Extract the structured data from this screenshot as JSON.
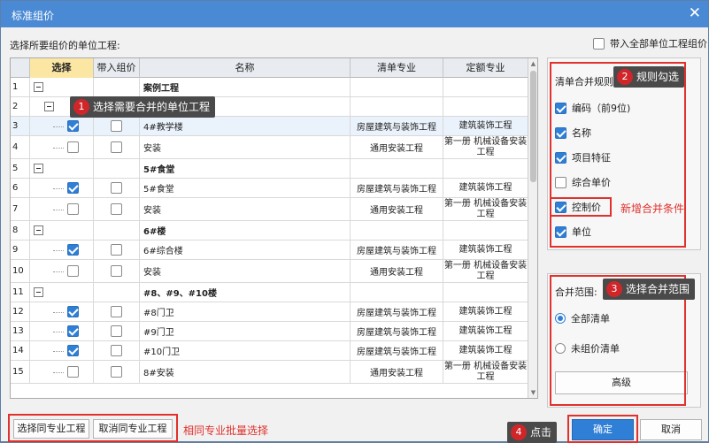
{
  "dialog": {
    "title": "标准组价",
    "close_icon": "✕"
  },
  "instruction": "选择所要组价的单位工程:",
  "bring_all": {
    "label": "带入全部单位工程组价",
    "checked": false
  },
  "grid": {
    "headers": [
      "",
      "选择",
      "带入组价",
      "名称",
      "清单专业",
      "定额专业"
    ],
    "rows": [
      {
        "no": "1",
        "group": true,
        "expander": true,
        "name": "案例工程",
        "qd": "",
        "de": "",
        "sel": null,
        "bring": null
      },
      {
        "no": "2",
        "group": true,
        "expander": true,
        "name": "",
        "qd": "",
        "de": "",
        "sel": null,
        "bring": null
      },
      {
        "no": "3",
        "group": false,
        "name": "4#教学楼",
        "qd": "房屋建筑与装饰工程",
        "de": "建筑装饰工程",
        "sel": true,
        "bring": false,
        "highlight": true
      },
      {
        "no": "4",
        "group": false,
        "name": "安装",
        "qd": "通用安装工程",
        "de": "第一册 机械设备安装工程",
        "sel": false,
        "bring": false
      },
      {
        "no": "5",
        "group": true,
        "expander": true,
        "name": "5#食堂",
        "qd": "",
        "de": "",
        "sel": null,
        "bring": null
      },
      {
        "no": "6",
        "group": false,
        "name": "5#食堂",
        "qd": "房屋建筑与装饰工程",
        "de": "建筑装饰工程",
        "sel": true,
        "bring": false
      },
      {
        "no": "7",
        "group": false,
        "name": "安装",
        "qd": "通用安装工程",
        "de": "第一册 机械设备安装工程",
        "sel": false,
        "bring": false
      },
      {
        "no": "8",
        "group": true,
        "expander": true,
        "name": "6#楼",
        "qd": "",
        "de": "",
        "sel": null,
        "bring": null
      },
      {
        "no": "9",
        "group": false,
        "name": "6#综合楼",
        "qd": "房屋建筑与装饰工程",
        "de": "建筑装饰工程",
        "sel": true,
        "bring": false
      },
      {
        "no": "10",
        "group": false,
        "name": "安装",
        "qd": "通用安装工程",
        "de": "第一册 机械设备安装工程",
        "sel": false,
        "bring": false
      },
      {
        "no": "11",
        "group": true,
        "expander": true,
        "name": "#8、#9、#10楼",
        "qd": "",
        "de": "",
        "sel": null,
        "bring": null
      },
      {
        "no": "12",
        "group": false,
        "name": "#8门卫",
        "qd": "房屋建筑与装饰工程",
        "de": "建筑装饰工程",
        "sel": true,
        "bring": false
      },
      {
        "no": "13",
        "group": false,
        "name": "#9门卫",
        "qd": "房屋建筑与装饰工程",
        "de": "建筑装饰工程",
        "sel": true,
        "bring": false
      },
      {
        "no": "14",
        "group": false,
        "name": "#10门卫",
        "qd": "房屋建筑与装饰工程",
        "de": "建筑装饰工程",
        "sel": true,
        "bring": false
      },
      {
        "no": "15",
        "group": false,
        "name": "8#安装",
        "qd": "通用安装工程",
        "de": "第一册 机械设备安装工程",
        "sel": false,
        "bring": false
      }
    ]
  },
  "merge_rules": {
    "title": "清单合并规则:",
    "items": [
      {
        "label": "编码（前9位)",
        "checked": true
      },
      {
        "label": "名称",
        "checked": true
      },
      {
        "label": "项目特征",
        "checked": true
      },
      {
        "label": "综合单价",
        "checked": false
      },
      {
        "label": "控制价",
        "checked": true
      },
      {
        "label": "单位",
        "checked": true
      }
    ]
  },
  "merge_scope": {
    "title": "合并范围:",
    "options": [
      {
        "label": "全部清单",
        "selected": true
      },
      {
        "label": "未组价清单",
        "selected": false
      }
    ],
    "advanced": "高级"
  },
  "bottom": {
    "select_same": "选择同专业工程",
    "cancel_same": "取消同专业工程",
    "batch_note": "相同专业批量选择",
    "ok": "确定",
    "cancel": "取消"
  },
  "annotations": {
    "c1": {
      "num": "1",
      "text": "选择需要合并的单位工程"
    },
    "c2": {
      "num": "2",
      "text": "规则勾选"
    },
    "c3": {
      "num": "3",
      "text": "选择合并范围"
    },
    "c4": {
      "num": "4",
      "text": "点击"
    },
    "new_condition": "新增合并条件"
  },
  "colors": {
    "accent": "#2f7fd6",
    "title_bar": "#4a8ad4",
    "annotation_red": "#e0312d"
  }
}
